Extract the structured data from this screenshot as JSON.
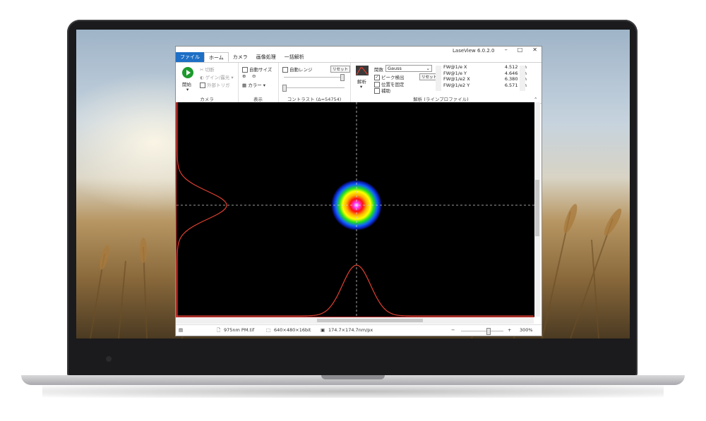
{
  "window": {
    "title": "LaseView 6.0.2.0",
    "controls": [
      "–",
      "□",
      "✕"
    ]
  },
  "tabs": [
    "ファイル",
    "ホーム",
    "カメラ",
    "画像処理",
    "一括解析"
  ],
  "ribbon": {
    "camera": {
      "start_label": "開始",
      "switch_label": "切断",
      "gain_label": "ゲイン/露光",
      "trigger_label": "外部トリガ",
      "group_label": "カメラ"
    },
    "display": {
      "auto_size_label": "自動サイズ",
      "color_label": "カラー",
      "group_label": "表示"
    },
    "contrast": {
      "auto_range_label": "自動レンジ",
      "reset_label": "リセット",
      "group_label": "コントラスト (Δ=54754)"
    },
    "analysis": {
      "analyze_label": "解析",
      "function_label": "関数",
      "function_value": "Gauss",
      "peak_label": "ピーク検出",
      "peak_checked": true,
      "fix_pos_label": "位置を固定",
      "fix_pos_checked": false,
      "extra_label": "補助",
      "reset_label": "リセット",
      "group_label": "解析 (ラインプロファイル)"
    },
    "results": [
      {
        "name": "FW@1/e X",
        "value": "4.512 μm"
      },
      {
        "name": "FW@1/e Y",
        "value": "4.646 μm"
      },
      {
        "name": "FW@1/e2 X",
        "value": "6.380 μm"
      },
      {
        "name": "FW@1/e2 Y",
        "value": "6.571 μm"
      }
    ]
  },
  "statusbar": {
    "file": "975nm PM.tif",
    "format": "640×480×16bit",
    "pixel": "174.7×174.7nm/px",
    "zoom": "300%",
    "zoom_level": 0.3
  },
  "colors": {
    "file_tab": "#1e6fc5",
    "start_button": "#1c9a2c",
    "profile_line": "#e04030",
    "canvas": "#000000"
  }
}
